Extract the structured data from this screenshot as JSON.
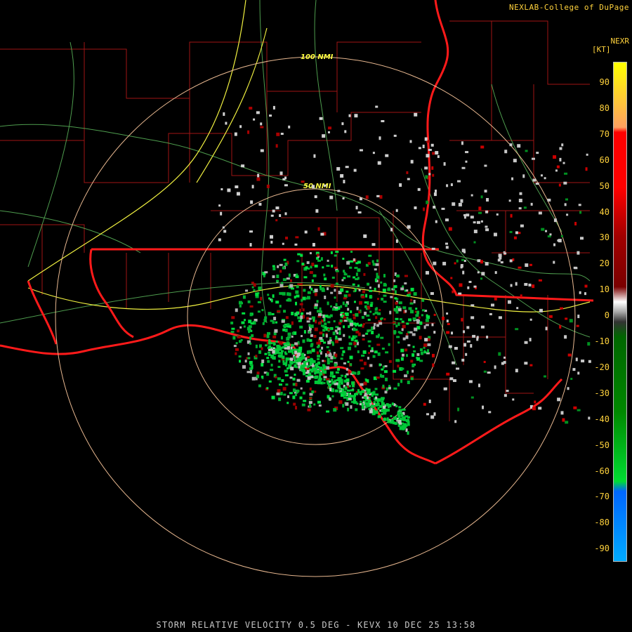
{
  "header": {
    "credit": "NEXLAB-College of DuPage",
    "product_short": "NEXR",
    "units": "[KT]"
  },
  "footer": {
    "caption": "STORM RELATIVE VELOCITY 0.5 DEG - KEVX 10 DEC 25 13:58"
  },
  "range_rings": [
    {
      "label": "50 NMI"
    },
    {
      "label": "100 NMI"
    }
  ],
  "legend": {
    "ticks": [
      "90",
      "80",
      "70",
      "60",
      "50",
      "40",
      "30",
      "20",
      "10",
      "0",
      "-10",
      "-20",
      "-30",
      "-40",
      "-50",
      "-60",
      "-70",
      "-80",
      "-90"
    ],
    "colors": {
      "positive_high": "#ffff00",
      "positive_mid": "#ff0000",
      "positive_low": "#7a0000",
      "zero": "#aaaaaa",
      "negative_low": "#006600",
      "negative_mid": "#00dd33",
      "negative_high": "#0066ff"
    }
  },
  "map_colors": {
    "state_border": "#ff2020",
    "county_border": "#b01818",
    "highway": "#ffff40",
    "road": "#60c060",
    "ring": "#e8b890"
  }
}
